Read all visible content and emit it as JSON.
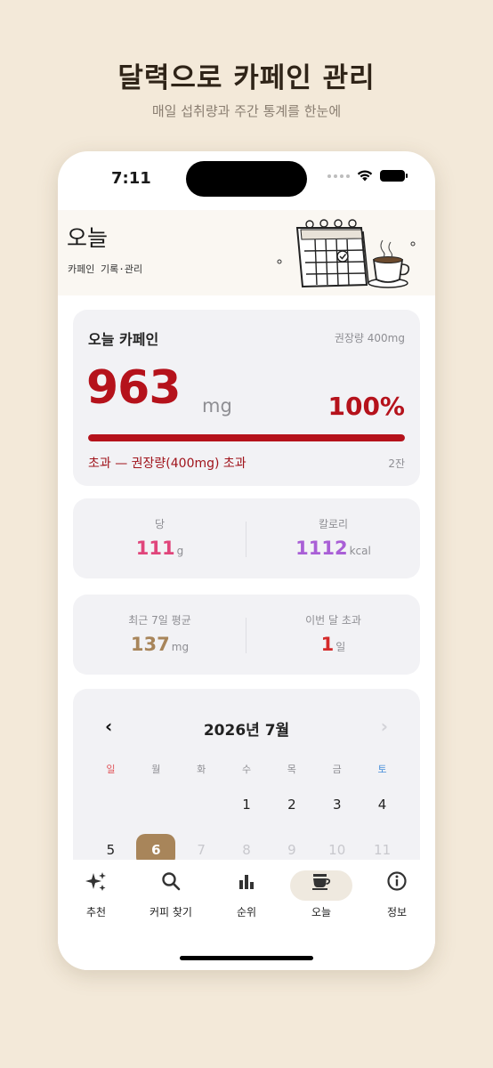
{
  "hero": {
    "title": "달력으로 카페인 관리",
    "subtitle": "매일 섭취량과 주간 통계를 한눈에"
  },
  "status_bar": {
    "time": "7:11"
  },
  "banner": {
    "title": "오늘",
    "subtitle": "카페인 기록·관리",
    "art": "calendar-coffee-illustration"
  },
  "today_card": {
    "title": "오늘 카페인",
    "recommended": "권장량 400mg",
    "value": "963",
    "unit": "mg",
    "percent": "100%",
    "progress": 1.0,
    "note": "초과 — 권장량(400mg) 초과",
    "cup_count": "2잔",
    "accent_color": "#b5121b"
  },
  "nutrition_card": {
    "sugar": {
      "label": "당",
      "value": "111",
      "unit": "g",
      "color": "#e0457b"
    },
    "calories": {
      "label": "칼로리",
      "value": "1112",
      "unit": "kcal",
      "color": "#a95fd6"
    }
  },
  "summary_card": {
    "weekly_avg": {
      "label": "최근 7일 평균",
      "value": "137",
      "unit": "mg",
      "color": "#a8855a"
    },
    "month_exceed": {
      "label": "이번 달 초과",
      "value": "1",
      "unit": "일",
      "color": "#d42a2a"
    }
  },
  "calendar": {
    "title": "2026년 7월",
    "prev_icon": "chevron-left-icon",
    "next_icon": "chevron-right-icon",
    "weekdays": [
      {
        "label": "일",
        "color": "#e0555a"
      },
      {
        "label": "월",
        "color": "#8e8e93"
      },
      {
        "label": "화",
        "color": "#8e8e93"
      },
      {
        "label": "수",
        "color": "#8e8e93"
      },
      {
        "label": "목",
        "color": "#8e8e93"
      },
      {
        "label": "금",
        "color": "#8e8e93"
      },
      {
        "label": "토",
        "color": "#4a90d9"
      }
    ],
    "rows": [
      [
        "",
        "",
        "",
        "1",
        "2",
        "3",
        "4"
      ],
      [
        "5",
        "6",
        "7",
        "8",
        "9",
        "10",
        "11"
      ]
    ],
    "selected_day": "6",
    "future_days": [
      "7",
      "8",
      "9",
      "10",
      "11"
    ]
  },
  "tabbar": {
    "tabs": [
      {
        "label": "추천",
        "icon": "sparkles-icon"
      },
      {
        "label": "커피 찾기",
        "icon": "search-icon"
      },
      {
        "label": "순위",
        "icon": "bar-chart-icon"
      },
      {
        "label": "오늘",
        "icon": "coffee-cup-icon",
        "active": true
      },
      {
        "label": "정보",
        "icon": "info-icon"
      }
    ]
  }
}
